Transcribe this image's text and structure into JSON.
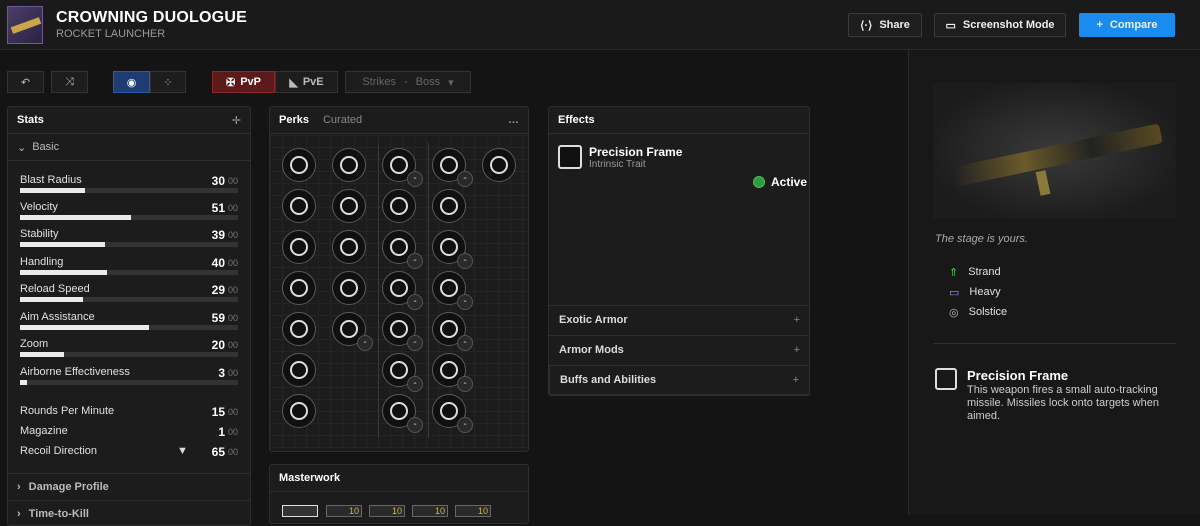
{
  "weapon": {
    "name": "CROWNING DUOLOGUE",
    "type": "ROCKET LAUNCHER",
    "flavor": "The stage is yours."
  },
  "header": {
    "share": "Share",
    "screenshot": "Screenshot Mode",
    "compare": "Compare"
  },
  "toolbar": {
    "pvp": "PvP",
    "pve": "PvE",
    "activity": "Strikes",
    "difficulty": "Boss"
  },
  "stats": {
    "title": "Stats",
    "section": "Basic",
    "items": [
      {
        "label": "Blast Radius",
        "value": "30",
        "fill": 0.3
      },
      {
        "label": "Velocity",
        "value": "51",
        "fill": 0.51
      },
      {
        "label": "Stability",
        "value": "39",
        "fill": 0.39
      },
      {
        "label": "Handling",
        "value": "40",
        "fill": 0.4
      },
      {
        "label": "Reload Speed",
        "value": "29",
        "fill": 0.29
      },
      {
        "label": "Aim Assistance",
        "value": "59",
        "fill": 0.59
      },
      {
        "label": "Zoom",
        "value": "20",
        "fill": 0.2
      },
      {
        "label": "Airborne Effectiveness",
        "value": "3",
        "fill": 0.03
      }
    ],
    "extra": [
      {
        "label": "Rounds Per Minute",
        "value": "15"
      },
      {
        "label": "Magazine",
        "value": "1"
      },
      {
        "label": "Recoil Direction",
        "value": "65"
      }
    ],
    "suffix": "00",
    "damage_profile": "Damage Profile",
    "ttk": "Time-to-Kill"
  },
  "perks": {
    "tab_active": "Perks",
    "tab_other": "Curated",
    "menu": "…"
  },
  "masterwork": {
    "title": "Masterwork",
    "level": "10"
  },
  "effects": {
    "title": "Effects",
    "trait_name": "Precision Frame",
    "trait_type": "Intrinsic Trait",
    "status": "Active",
    "sections": [
      "Exotic Armor",
      "Armor Mods",
      "Buffs and Abilities"
    ]
  },
  "sidebar": {
    "tags": [
      "Strand",
      "Heavy",
      "Solstice"
    ],
    "frame_name": "Precision Frame",
    "frame_desc": "This weapon fires a small auto-tracking missile. Missiles lock onto targets when aimed."
  }
}
